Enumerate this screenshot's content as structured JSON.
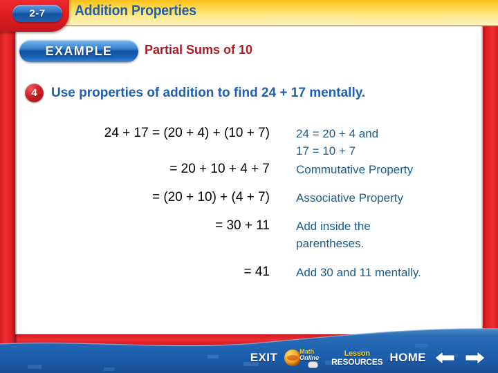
{
  "header": {
    "lesson_number": "2-7",
    "title": "Addition Properties"
  },
  "example": {
    "badge_label": "EXAMPLE",
    "title": "Partial Sums of 10"
  },
  "step": {
    "number": "4",
    "instruction": "Use properties of addition to find 24 + 17 mentally."
  },
  "work": {
    "rows": [
      {
        "expression": "24 + 17 = (20 + 4) + (10 + 7)",
        "reason": "24 = 20 + 4 and\n17 = 10 + 7"
      },
      {
        "expression": "= 20 + 10 + 4 + 7",
        "reason": "Commutative Property"
      },
      {
        "expression": "= (20 + 10) + (4 + 7)",
        "reason": "Associative Property"
      },
      {
        "expression": "= 30 + 11",
        "reason": "Add inside the\nparentheses."
      },
      {
        "expression": "= 41",
        "reason": "Add 30 and 11 mentally."
      }
    ]
  },
  "footer": {
    "exit_label": "EXIT",
    "logo_math": "Math",
    "logo_online": "Online",
    "resources_line1": "Lesson",
    "resources_line2": "RESOURCES",
    "home_label": "HOME",
    "back_icon": "arrow-left-icon",
    "forward_icon": "arrow-right-icon"
  },
  "colors": {
    "frame_red": "#e12026",
    "banner_yellow": "#fbc01a",
    "title_blue": "#1f5fae",
    "example_red": "#a81d24",
    "reason_blue": "#1a5d91",
    "footer_blue": "#1b5fae"
  }
}
